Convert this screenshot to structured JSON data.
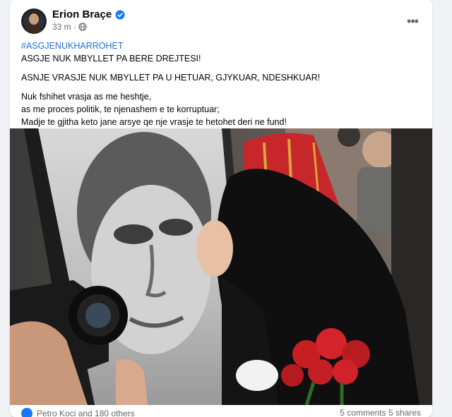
{
  "post": {
    "author": "Erion Braçe",
    "time": "33 m",
    "separator": "·",
    "hashtag": "#ASGJENUKHARROHET",
    "paragraphs": [
      "ASGJE NUK MBYLLET PA BERE DREJTESI!",
      "ASNJE VRASJE NUK MBYLLET PA U HETUAR, GJYKUAR, NDESHKUAR!"
    ],
    "lines": [
      "Nuk fshihet vrasja as me heshtje,",
      "as me proces politik, te njenashem e te korruptuar;",
      "Madje te gjitha keto jane arsye qe nje vrasje te hetohet deri ne fund!"
    ],
    "reactions": "Petro Koci and 180 others",
    "stats": "5 comments  5 shares"
  },
  "colors": {
    "accent": "#1877f2",
    "hashtag": "#216fdb",
    "secondary_text": "#65676b"
  },
  "icons": [
    "verified-badge-icon",
    "globe-icon",
    "more-options-icon",
    "like-reaction-icon"
  ]
}
